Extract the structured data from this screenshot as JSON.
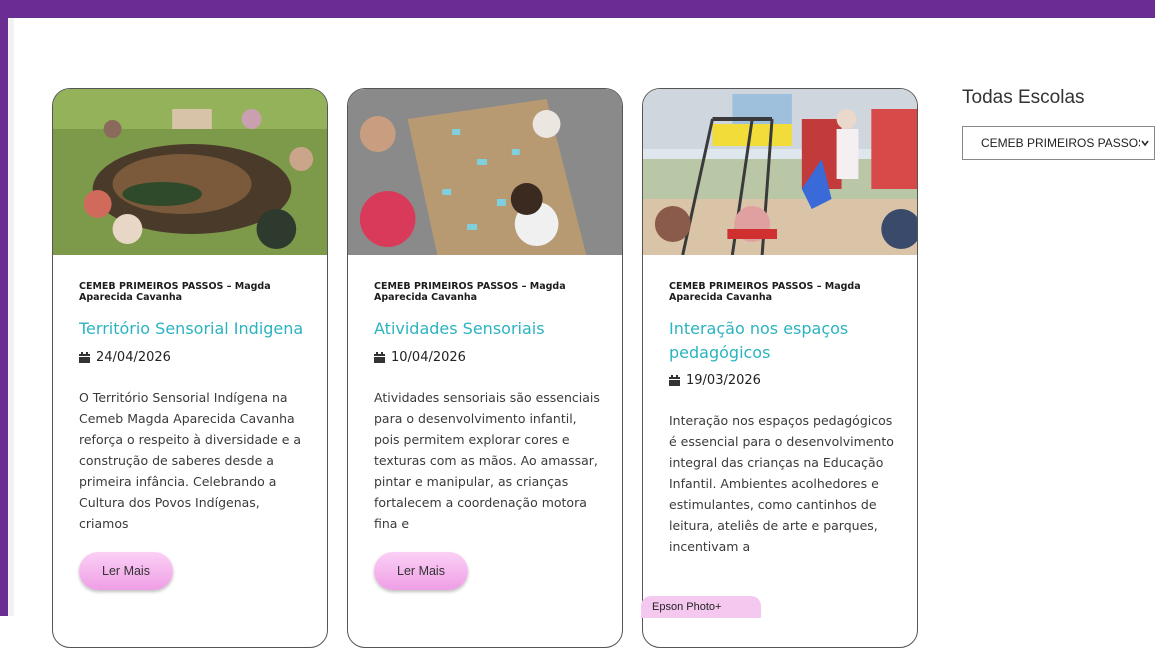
{
  "filter": {
    "title": "Todas Escolas",
    "selected": "CEMEB PRIMEIROS PASSOS"
  },
  "cards": [
    {
      "school": "CEMEB PRIMEIROS PASSOS – Magda Aparecida Cavanha",
      "title": "Território Sensorial Indigena",
      "date": "24/04/2026",
      "excerpt": "O Território Sensorial Indígena na Cemeb Magda Aparecida Cavanha reforça o respeito à diversidade e a construção de saberes desde a primeira infância. Celebrando a Cultura dos Povos Indígenas, criamos",
      "button": "Ler Mais"
    },
    {
      "school": "CEMEB PRIMEIROS PASSOS – Magda Aparecida Cavanha",
      "title": "Atividades Sensoriais",
      "date": "10/04/2026",
      "excerpt": "Atividades sensoriais são essenciais para o desenvolvimento infantil, pois permitem explorar cores e texturas com as mãos. Ao amassar, pintar e manipular, as crianças fortalecem a coordenação motora fina e",
      "button": "Ler Mais"
    },
    {
      "school": "CEMEB PRIMEIROS PASSOS – Magda Aparecida Cavanha",
      "title": "Interação nos espaços pedagógicos",
      "date": "19/03/2026",
      "excerpt": "Interação nos espaços pedagógicos é essencial para o desenvolvimento integral das crianças na Educação Infantil. Ambientes acolhedores e estimulantes, como cantinhos de leitura, ateliês de arte e parques, incentivam a"
    }
  ],
  "taskbar": {
    "label": "Epson Photo+"
  },
  "icons": {
    "date": "calendar-icon",
    "dropdown": "chevron-down-icon"
  },
  "colors": {
    "frame": "#6a2e93",
    "title": "#2bb3c0",
    "button": "#ef9ee6"
  }
}
